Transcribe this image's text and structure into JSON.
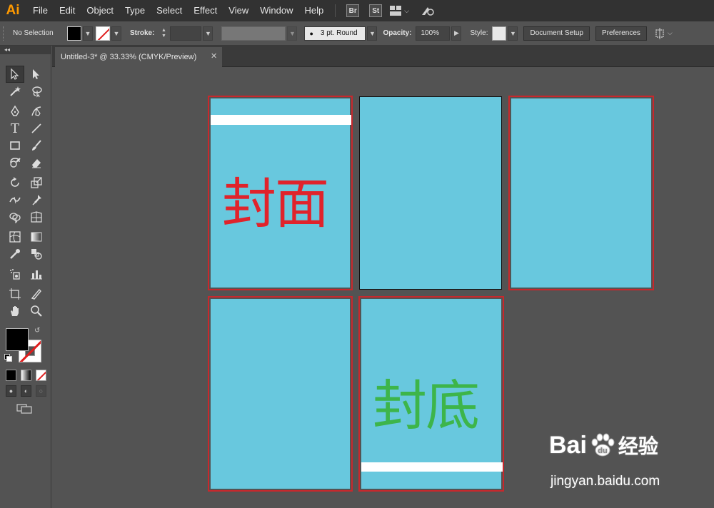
{
  "app": {
    "logo": "Ai"
  },
  "menu": [
    "File",
    "Edit",
    "Object",
    "Type",
    "Select",
    "Effect",
    "View",
    "Window",
    "Help"
  ],
  "menubar_badges": {
    "bridge": "Br",
    "stock": "St"
  },
  "control": {
    "selection_status": "No Selection",
    "stroke_label": "Stroke:",
    "brush_value": "3 pt. Round",
    "opacity_label": "Opacity:",
    "opacity_value": "100%",
    "style_label": "Style:",
    "document_setup": "Document Setup",
    "preferences": "Preferences"
  },
  "tools_panel": {
    "collapse": "◂◂"
  },
  "document_tab": {
    "title": "Untitled-3* @ 33.33% (CMYK/Preview)",
    "close": "✕"
  },
  "artboards": {
    "cover_text": "封面",
    "back_text": "封底",
    "cover_text_color": "#e0232b",
    "back_text_color": "#3db54a",
    "artboard_color": "#68c8de",
    "selection_color": "#c8282c"
  },
  "watermark": {
    "logo_left": "Bai",
    "logo_right": "经验",
    "logo_mid": "du",
    "url": "jingyan.baidu.com"
  },
  "icons": [
    "selection-tool-icon",
    "direct-selection-tool-icon",
    "magic-wand-icon",
    "lasso-icon",
    "pen-icon",
    "curvature-icon",
    "type-icon",
    "line-icon",
    "rectangle-icon",
    "paintbrush-icon",
    "shaper-icon",
    "eraser-icon",
    "rotate-icon",
    "scale-icon",
    "width-icon",
    "puppet-warp-icon",
    "shape-builder-icon",
    "perspective-grid-icon",
    "mesh-icon",
    "gradient-icon",
    "eyedropper-icon",
    "blend-icon",
    "symbol-sprayer-icon",
    "column-graph-icon",
    "artboard-tool-icon",
    "slice-icon",
    "hand-icon",
    "zoom-icon"
  ]
}
